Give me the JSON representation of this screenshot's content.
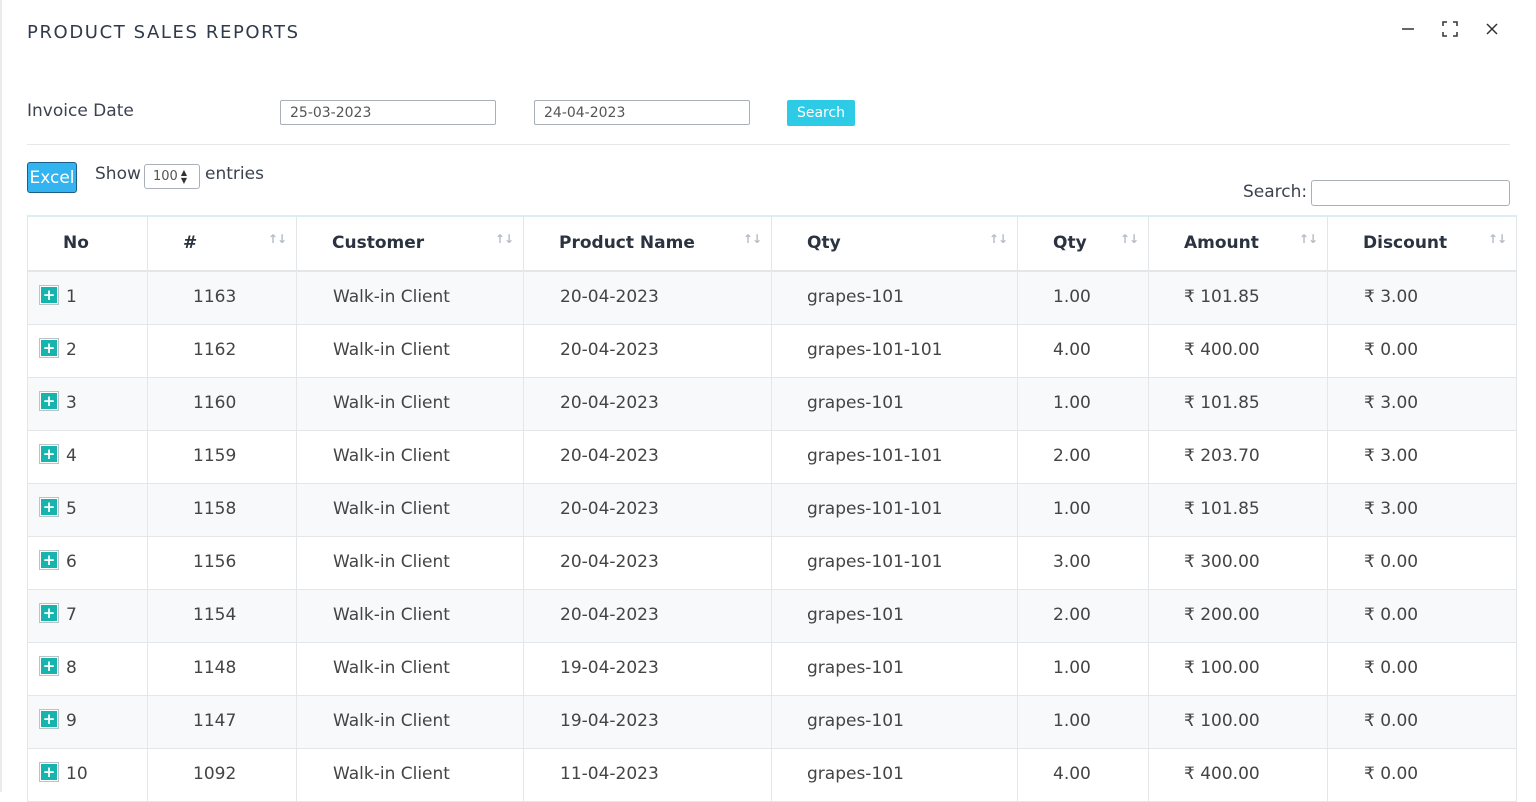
{
  "window": {
    "title": "PRODUCT SALES REPORTS",
    "controls": [
      "minimize-icon",
      "maximize-icon",
      "close-icon"
    ]
  },
  "filter": {
    "label": "Invoice Date",
    "from_date": "25-03-2023",
    "to_date": "24-04-2023",
    "search_button": "Search"
  },
  "toolbar": {
    "excel_button": "Excel",
    "show_label": "Show",
    "entries_value": "100",
    "entries_label": "entries",
    "search_label": "Search:",
    "search_value": ""
  },
  "colors": {
    "search_button": "#2ecbe6",
    "excel_button": "#33b3f0",
    "expand_icon": "#17b3ad"
  },
  "table": {
    "columns": [
      "No",
      "#",
      "Customer",
      "Product Name",
      "Qty",
      "Qty",
      "Amount",
      "Discount"
    ],
    "rows": [
      {
        "no": "1",
        "id": "1163",
        "customer": "Walk-in Client",
        "product": "20-04-2023",
        "qty1": "grapes-101",
        "qty2": "1.00",
        "amount": "₹ 101.85",
        "discount": "₹ 3.00"
      },
      {
        "no": "2",
        "id": "1162",
        "customer": "Walk-in Client",
        "product": "20-04-2023",
        "qty1": "grapes-101-101",
        "qty2": "4.00",
        "amount": "₹ 400.00",
        "discount": "₹ 0.00"
      },
      {
        "no": "3",
        "id": "1160",
        "customer": "Walk-in Client",
        "product": "20-04-2023",
        "qty1": "grapes-101",
        "qty2": "1.00",
        "amount": "₹ 101.85",
        "discount": "₹ 3.00"
      },
      {
        "no": "4",
        "id": "1159",
        "customer": "Walk-in Client",
        "product": "20-04-2023",
        "qty1": "grapes-101-101",
        "qty2": "2.00",
        "amount": "₹ 203.70",
        "discount": "₹ 3.00"
      },
      {
        "no": "5",
        "id": "1158",
        "customer": "Walk-in Client",
        "product": "20-04-2023",
        "qty1": "grapes-101-101",
        "qty2": "1.00",
        "amount": "₹ 101.85",
        "discount": "₹ 3.00"
      },
      {
        "no": "6",
        "id": "1156",
        "customer": "Walk-in Client",
        "product": "20-04-2023",
        "qty1": "grapes-101-101",
        "qty2": "3.00",
        "amount": "₹ 300.00",
        "discount": "₹ 0.00"
      },
      {
        "no": "7",
        "id": "1154",
        "customer": "Walk-in Client",
        "product": "20-04-2023",
        "qty1": "grapes-101",
        "qty2": "2.00",
        "amount": "₹ 200.00",
        "discount": "₹ 0.00"
      },
      {
        "no": "8",
        "id": "1148",
        "customer": "Walk-in Client",
        "product": "19-04-2023",
        "qty1": "grapes-101",
        "qty2": "1.00",
        "amount": "₹ 100.00",
        "discount": "₹ 0.00"
      },
      {
        "no": "9",
        "id": "1147",
        "customer": "Walk-in Client",
        "product": "19-04-2023",
        "qty1": "grapes-101",
        "qty2": "1.00",
        "amount": "₹ 100.00",
        "discount": "₹ 0.00"
      },
      {
        "no": "10",
        "id": "1092",
        "customer": "Walk-in Client",
        "product": "11-04-2023",
        "qty1": "grapes-101",
        "qty2": "4.00",
        "amount": "₹ 400.00",
        "discount": "₹ 0.00"
      }
    ]
  }
}
